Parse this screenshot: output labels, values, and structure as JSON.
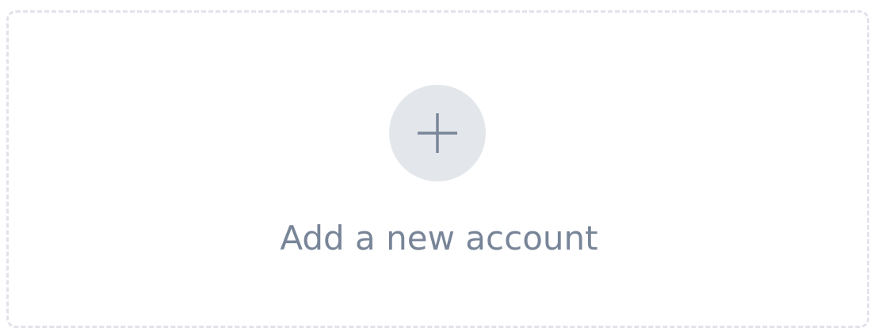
{
  "add_account": {
    "label": "Add a new account",
    "icon": "plus-icon",
    "colors": {
      "border": "#e2e3ea",
      "circle": "#e3e6eb",
      "text": "#788598"
    }
  }
}
